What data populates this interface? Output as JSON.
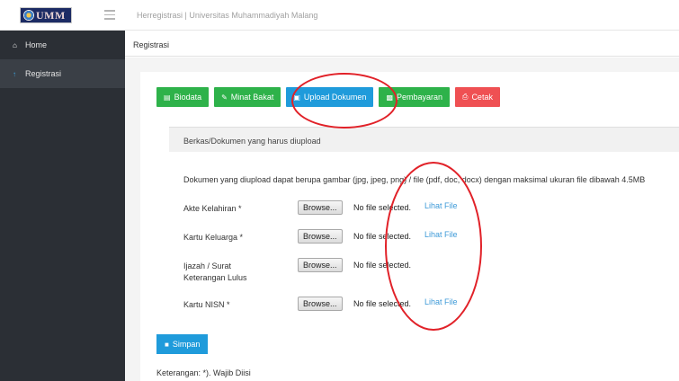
{
  "header": {
    "brand": "UMM",
    "app_title": "Herregistrasi | Universitas Muhammadiyah Malang"
  },
  "sidebar": {
    "items": [
      {
        "label": "Home",
        "icon": "home-icon"
      },
      {
        "label": "Registrasi",
        "icon": "arrow-up-icon"
      }
    ]
  },
  "breadcrumb": "Registrasi",
  "tabs": [
    {
      "label": "Biodata",
      "icon": "idcard-icon",
      "color": "#2eb24a"
    },
    {
      "label": "Minat Bakat",
      "icon": "tag-icon",
      "color": "#2eb24a"
    },
    {
      "label": "Upload Dokumen",
      "icon": "file-icon",
      "color": "#1f9bdb"
    },
    {
      "label": "Pembayaran",
      "icon": "money-icon",
      "color": "#2eb24a"
    },
    {
      "label": "Cetak",
      "icon": "print-icon",
      "color": "#ef5053"
    }
  ],
  "section_title": "Berkas/Dokumen yang harus diupload",
  "note": "Dokumen yang diupload dapat berupa gambar (jpg, jpeg, png) / file (pdf, doc, docx) dengan maksimal ukuran file dibawah 4.5MB",
  "fields": [
    {
      "label": "Akte Kelahiran *",
      "browse": "Browse...",
      "status": "No file selected.",
      "link": "Lihat File"
    },
    {
      "label": "Kartu Keluarga *",
      "browse": "Browse...",
      "status": "No file selected.",
      "link": "Lihat File"
    },
    {
      "label": "Ijazah / Surat Keterangan Lulus",
      "browse": "Browse...",
      "status": "No file selected.",
      "link": ""
    },
    {
      "label": "Kartu NISN *",
      "browse": "Browse...",
      "status": "No file selected.",
      "link": "Lihat File"
    }
  ],
  "save_label": "Simpan",
  "footer_note": "Keterangan: *). Wajib Diisi",
  "colors": {
    "sidebar": "#2b2f35",
    "accent": "#1f9bdb",
    "success": "#2eb24a",
    "danger": "#ef5053",
    "annotation": "#e12128"
  }
}
